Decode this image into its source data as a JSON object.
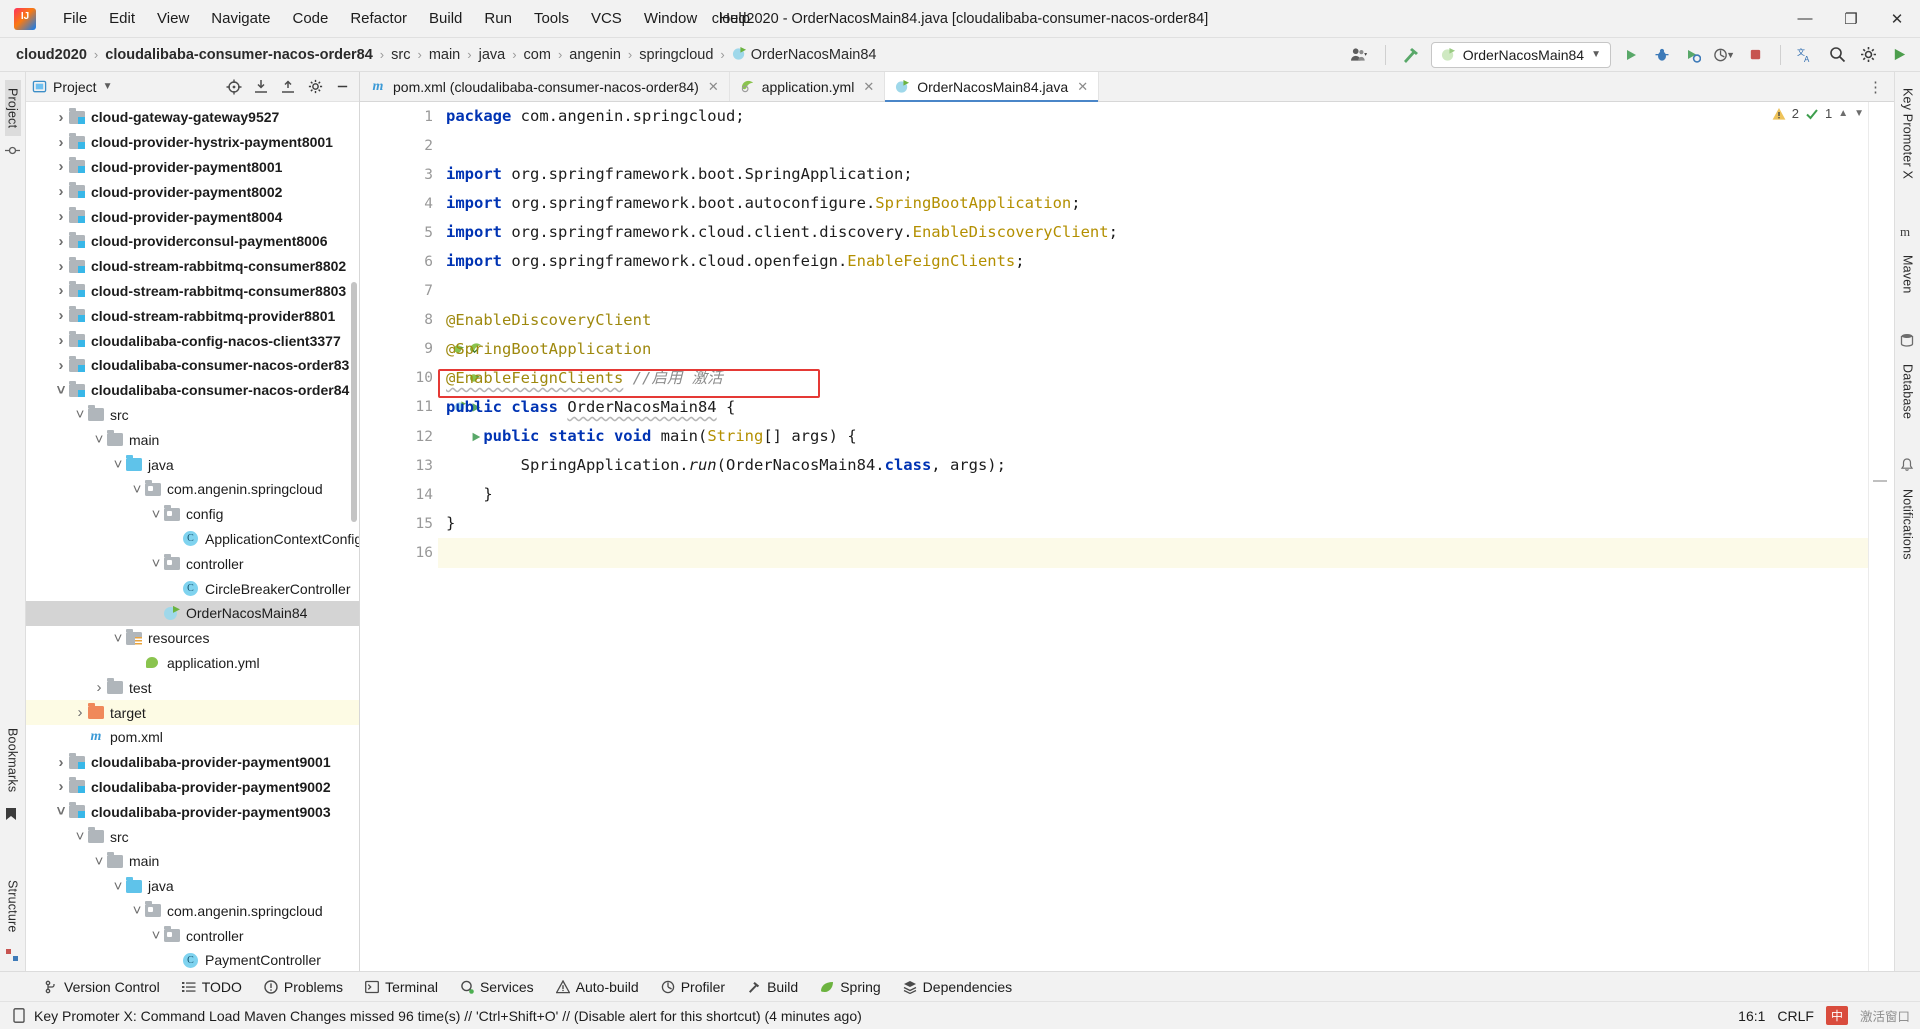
{
  "window": {
    "title": "cloud2020 - OrderNacosMain84.java [cloudalibaba-consumer-nacos-order84]",
    "minimize_label": "—",
    "maximize_label": "❐",
    "close_label": "✕"
  },
  "menu": {
    "items": [
      "File",
      "Edit",
      "View",
      "Navigate",
      "Code",
      "Refactor",
      "Build",
      "Run",
      "Tools",
      "VCS",
      "Window",
      "Help"
    ]
  },
  "breadcrumb": {
    "items": [
      {
        "label": "cloud2020",
        "bold": true
      },
      {
        "label": "cloudalibaba-consumer-nacos-order84",
        "bold": true
      },
      {
        "label": "src",
        "bold": false
      },
      {
        "label": "main",
        "bold": false
      },
      {
        "label": "java",
        "bold": false
      },
      {
        "label": "com",
        "bold": false
      },
      {
        "label": "angenin",
        "bold": false
      },
      {
        "label": "springcloud",
        "bold": false
      },
      {
        "label": "OrderNacosMain84",
        "bold": false,
        "icon": "spring-boot-class-icon"
      }
    ],
    "separator": "›"
  },
  "navbar_right": {
    "account_icon": "user-account-icon",
    "build_icon": "hammer-build-icon",
    "run_config": {
      "icon": "spring-boot-run-icon",
      "label": "OrderNacosMain84",
      "dropdown_icon": "chevron-down-icon"
    },
    "actions": [
      {
        "name": "run-button",
        "icon": "run-play-icon"
      },
      {
        "name": "debug-button",
        "icon": "debug-bug-icon"
      },
      {
        "name": "run-with-coverage-button",
        "icon": "coverage-icon"
      },
      {
        "name": "profile-button",
        "icon": "profiler-icon"
      },
      {
        "name": "stop-button",
        "icon": "stop-square-icon"
      },
      {
        "name": "translate-button",
        "icon": "translate-icon"
      },
      {
        "name": "search-everywhere-button",
        "icon": "search-icon"
      },
      {
        "name": "settings-button",
        "icon": "gear-icon"
      },
      {
        "name": "update-project-button",
        "icon": "play-green-icon"
      }
    ]
  },
  "left_rail": {
    "items": [
      {
        "label": "Project",
        "selected": true,
        "name": "rail-project"
      },
      {
        "label": "Bookmarks",
        "selected": false,
        "name": "rail-bookmarks"
      },
      {
        "label": "Structure",
        "selected": false,
        "name": "rail-structure"
      }
    ]
  },
  "right_rail": {
    "items": [
      {
        "label": "Key Promoter X",
        "name": "rail-key-promoter-x"
      },
      {
        "label": "Maven",
        "name": "rail-maven"
      },
      {
        "label": "Database",
        "name": "rail-database"
      },
      {
        "label": "Notifications",
        "name": "rail-notifications"
      }
    ]
  },
  "project_panel": {
    "title": "Project",
    "title_dropdown": "▾",
    "header_actions": [
      {
        "name": "select-opened-file-icon",
        "glyph": "⊕"
      },
      {
        "name": "expand-all-icon",
        "glyph": "↧"
      },
      {
        "name": "collapse-all-icon",
        "glyph": "↥"
      },
      {
        "name": "panel-options-gear-icon",
        "glyph": "⚙"
      },
      {
        "name": "hide-panel-icon",
        "glyph": "—"
      }
    ],
    "tree": [
      {
        "label": "cloud-gateway-gateway9527",
        "indent": 1,
        "arrow": "collapsed",
        "icon": "module-folder-icon",
        "style": "module"
      },
      {
        "label": "cloud-provider-hystrix-payment8001",
        "indent": 1,
        "arrow": "collapsed",
        "icon": "module-folder-icon",
        "style": "module"
      },
      {
        "label": "cloud-provider-payment8001",
        "indent": 1,
        "arrow": "collapsed",
        "icon": "module-folder-icon",
        "style": "module"
      },
      {
        "label": "cloud-provider-payment8002",
        "indent": 1,
        "arrow": "collapsed",
        "icon": "module-folder-icon",
        "style": "module"
      },
      {
        "label": "cloud-provider-payment8004",
        "indent": 1,
        "arrow": "collapsed",
        "icon": "module-folder-icon",
        "style": "module"
      },
      {
        "label": "cloud-providerconsul-payment8006",
        "indent": 1,
        "arrow": "collapsed",
        "icon": "module-folder-icon",
        "style": "module"
      },
      {
        "label": "cloud-stream-rabbitmq-consumer8802",
        "indent": 1,
        "arrow": "collapsed",
        "icon": "module-folder-icon",
        "style": "module"
      },
      {
        "label": "cloud-stream-rabbitmq-consumer8803",
        "indent": 1,
        "arrow": "collapsed",
        "icon": "module-folder-icon",
        "style": "module"
      },
      {
        "label": "cloud-stream-rabbitmq-provider8801",
        "indent": 1,
        "arrow": "collapsed",
        "icon": "module-folder-icon",
        "style": "module"
      },
      {
        "label": "cloudalibaba-config-nacos-client3377",
        "indent": 1,
        "arrow": "collapsed",
        "icon": "module-folder-icon",
        "style": "module"
      },
      {
        "label": "cloudalibaba-consumer-nacos-order83",
        "indent": 1,
        "arrow": "collapsed",
        "icon": "module-folder-icon",
        "style": "module"
      },
      {
        "label": "cloudalibaba-consumer-nacos-order84",
        "indent": 1,
        "arrow": "expanded",
        "icon": "module-folder-icon",
        "style": "module"
      },
      {
        "label": "src",
        "indent": 2,
        "arrow": "expanded",
        "icon": "folder-icon",
        "style": "plain"
      },
      {
        "label": "main",
        "indent": 3,
        "arrow": "expanded",
        "icon": "folder-icon",
        "style": "plain"
      },
      {
        "label": "java",
        "indent": 4,
        "arrow": "expanded",
        "icon": "source-folder-icon",
        "style": "plain"
      },
      {
        "label": "com.angenin.springcloud",
        "indent": 5,
        "arrow": "expanded",
        "icon": "package-icon",
        "style": "plain"
      },
      {
        "label": "config",
        "indent": 6,
        "arrow": "expanded",
        "icon": "package-icon",
        "style": "plain"
      },
      {
        "label": "ApplicationContextConfig",
        "indent": 7,
        "arrow": "none",
        "icon": "java-class-icon",
        "style": "plain"
      },
      {
        "label": "controller",
        "indent": 6,
        "arrow": "expanded",
        "icon": "package-icon",
        "style": "plain"
      },
      {
        "label": "CircleBreakerController",
        "indent": 7,
        "arrow": "none",
        "icon": "java-class-icon",
        "style": "plain"
      },
      {
        "label": "OrderNacosMain84",
        "indent": 6,
        "arrow": "none",
        "icon": "spring-boot-class-icon",
        "style": "selected"
      },
      {
        "label": "resources",
        "indent": 4,
        "arrow": "expanded",
        "icon": "resources-folder-icon",
        "style": "plain"
      },
      {
        "label": "application.yml",
        "indent": 5,
        "arrow": "none",
        "icon": "spring-yaml-icon",
        "style": "plain"
      },
      {
        "label": "test",
        "indent": 3,
        "arrow": "collapsed",
        "icon": "folder-icon",
        "style": "plain"
      },
      {
        "label": "target",
        "indent": 2,
        "arrow": "collapsed",
        "icon": "target-folder-icon",
        "style": "highlight"
      },
      {
        "label": "pom.xml",
        "indent": 2,
        "arrow": "none",
        "icon": "maven-icon",
        "style": "plain"
      },
      {
        "label": "cloudalibaba-provider-payment9001",
        "indent": 1,
        "arrow": "collapsed",
        "icon": "module-folder-icon",
        "style": "module"
      },
      {
        "label": "cloudalibaba-provider-payment9002",
        "indent": 1,
        "arrow": "collapsed",
        "icon": "module-folder-icon",
        "style": "module"
      },
      {
        "label": "cloudalibaba-provider-payment9003",
        "indent": 1,
        "arrow": "expanded",
        "icon": "module-folder-icon",
        "style": "module"
      },
      {
        "label": "src",
        "indent": 2,
        "arrow": "expanded",
        "icon": "folder-icon",
        "style": "plain"
      },
      {
        "label": "main",
        "indent": 3,
        "arrow": "expanded",
        "icon": "folder-icon",
        "style": "plain"
      },
      {
        "label": "java",
        "indent": 4,
        "arrow": "expanded",
        "icon": "source-folder-icon",
        "style": "plain"
      },
      {
        "label": "com.angenin.springcloud",
        "indent": 5,
        "arrow": "expanded",
        "icon": "package-icon",
        "style": "plain"
      },
      {
        "label": "controller",
        "indent": 6,
        "arrow": "expanded",
        "icon": "package-icon",
        "style": "plain"
      },
      {
        "label": "PaymentController",
        "indent": 7,
        "arrow": "none",
        "icon": "java-class-icon",
        "style": "plain"
      }
    ]
  },
  "editor": {
    "tabs": [
      {
        "label": "pom.xml (cloudalibaba-consumer-nacos-order84)",
        "icon": "maven-icon",
        "active": false,
        "close": "✕"
      },
      {
        "label": "application.yml",
        "icon": "spring-yaml-icon",
        "active": false,
        "close": "✕"
      },
      {
        "label": "OrderNacosMain84.java",
        "icon": "spring-boot-class-icon",
        "active": true,
        "close": "✕"
      }
    ],
    "tabs_more_icon": "more-vertical-icon",
    "line_numbers": [
      "1",
      "2",
      "3",
      "4",
      "5",
      "6",
      "7",
      "8",
      "9",
      "10",
      "11",
      "12",
      "13",
      "14",
      "15",
      "16"
    ],
    "code_lines": [
      "package com.angenin.springcloud;",
      "",
      "import org.springframework.boot.SpringApplication;",
      "import org.springframework.boot.autoconfigure.SpringBootApplication;",
      "import org.springframework.cloud.client.discovery.EnableDiscoveryClient;",
      "import org.springframework.cloud.openfeign.EnableFeignClients;",
      "",
      "@EnableDiscoveryClient",
      "@SpringBootApplication",
      "@EnableFeignClients //启用 激活",
      "public class OrderNacosMain84 {",
      "    public static void main(String[] args) {",
      "        SpringApplication.run(OrderNacosMain84.class, args);",
      "    }",
      "}",
      ""
    ],
    "comment_text": "//启用 激活",
    "highlight_box": {
      "color": "#e53935",
      "line": 10,
      "label": "red-annotation-box"
    },
    "inspections": {
      "warning_icon": "warning-triangle-icon",
      "warning_count": "2",
      "weak_warning_icon": "weak-warning-icon",
      "weak_warning_count": "1",
      "prev_icon": "chevron-up-icon",
      "next_icon": "chevron-down-icon"
    }
  },
  "toolwindow_bar": {
    "items": [
      {
        "label": "Version Control",
        "icon": "branch-icon"
      },
      {
        "label": "TODO",
        "icon": "todo-list-icon"
      },
      {
        "label": "Problems",
        "icon": "problems-icon"
      },
      {
        "label": "Terminal",
        "icon": "terminal-icon"
      },
      {
        "label": "Services",
        "icon": "services-icon"
      },
      {
        "label": "Auto-build",
        "icon": "auto-build-icon"
      },
      {
        "label": "Profiler",
        "icon": "profiler-icon"
      },
      {
        "label": "Build",
        "icon": "hammer-build-icon"
      },
      {
        "label": "Spring",
        "icon": "spring-leaf-icon"
      },
      {
        "label": "Dependencies",
        "icon": "dependencies-icon"
      }
    ]
  },
  "statusbar": {
    "icon": "notification-note-icon",
    "message": "Key Promoter X: Command Load Maven Changes missed 96 time(s) // 'Ctrl+Shift+O' // (Disable alert for this shortcut) (4 minutes ago)",
    "caret_position": "16:1",
    "line_separator": "CRLF",
    "ime_label": "中",
    "watermark": "激活窗口"
  },
  "colors": {
    "accent_blue": "#4a86c8",
    "keyword_blue": "#0033b3",
    "annotation_gold": "#9e880d",
    "string_green": "#067d17",
    "red_box": "#e53935",
    "selection_gray": "#d4d4d4",
    "target_highlight": "#fdfbe4"
  }
}
